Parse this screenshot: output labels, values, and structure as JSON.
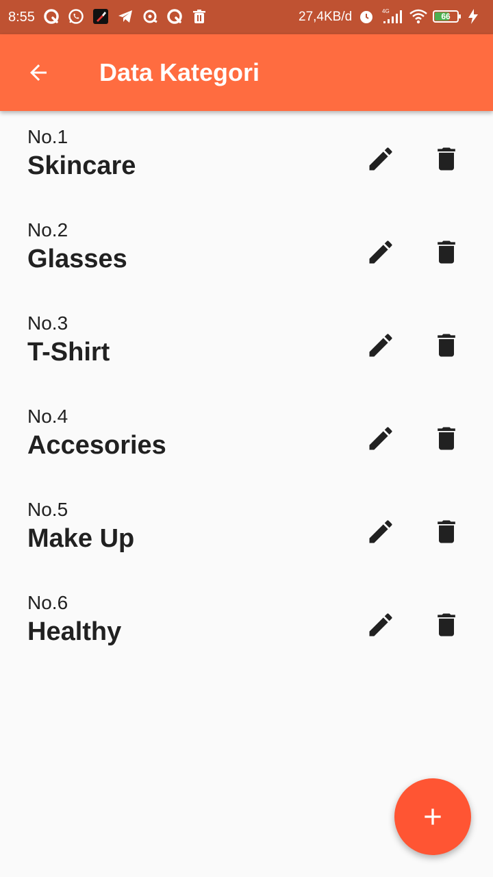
{
  "status_bar": {
    "time": "8:55",
    "network_speed": "27,4KB/d",
    "signal_type": "4G",
    "battery_level": "66",
    "icons_left": [
      "q-app-icon",
      "whatsapp-icon",
      "brush-app-icon",
      "telegram-icon",
      "sync-icon",
      "q-app-icon",
      "trash-notification-icon"
    ],
    "icons_right": [
      "alarm-icon",
      "signal-icon",
      "wifi-icon",
      "battery-icon",
      "charging-icon"
    ]
  },
  "app_bar": {
    "title": "Data Kategori",
    "back_icon": "arrow-back-icon",
    "color": "#ff6c40"
  },
  "categories": [
    {
      "number": "No.1",
      "name": "Skincare"
    },
    {
      "number": "No.2",
      "name": "Glasses"
    },
    {
      "number": "No.3",
      "name": "T-Shirt"
    },
    {
      "number": "No.4",
      "name": "Accesories"
    },
    {
      "number": "No.5",
      "name": "Make Up"
    },
    {
      "number": "No.6",
      "name": "Healthy"
    }
  ],
  "item_actions": {
    "edit_icon": "pencil-icon",
    "delete_icon": "trash-icon"
  },
  "fab": {
    "icon": "plus-icon",
    "color": "#ff5533"
  }
}
